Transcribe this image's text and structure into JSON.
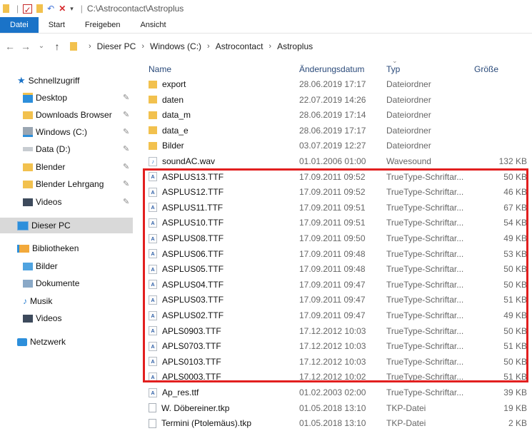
{
  "titlebar": {
    "path": "C:\\Astrocontact\\Astroplus",
    "icons": [
      "folder-icon",
      "properties-icon",
      "folder-icon",
      "undo-icon",
      "delete-icon",
      "dropdown-icon"
    ]
  },
  "ribbon": {
    "tabs": [
      "Datei",
      "Start",
      "Freigeben",
      "Ansicht"
    ],
    "accent": "#1a73c8"
  },
  "address": {
    "crumbs": [
      "Dieser PC",
      "Windows (C:)",
      "Astrocontact",
      "Astroplus"
    ]
  },
  "sidebar": {
    "items": [
      {
        "label": "Schnellzugriff",
        "icon": "star-icon",
        "pinned": false
      },
      {
        "label": "Desktop",
        "icon": "desktop-icon",
        "pinned": true
      },
      {
        "label": "Downloads Browser",
        "icon": "folder-icon",
        "pinned": true
      },
      {
        "label": "Windows (C:)",
        "icon": "drive-icon",
        "pinned": true
      },
      {
        "label": "Data (D:)",
        "icon": "drive-icon",
        "pinned": true
      },
      {
        "label": "Blender",
        "icon": "folder-icon",
        "pinned": true
      },
      {
        "label": "Blender Lehrgang",
        "icon": "folder-icon",
        "pinned": true
      },
      {
        "label": "Videos",
        "icon": "video-icon",
        "pinned": true
      },
      {
        "label": "Dieser PC",
        "icon": "computer-icon",
        "pinned": false,
        "selected": true
      },
      {
        "label": "Bibliotheken",
        "icon": "library-icon",
        "pinned": false
      },
      {
        "label": "Bilder",
        "icon": "pictures-icon",
        "pinned": false
      },
      {
        "label": "Dokumente",
        "icon": "documents-icon",
        "pinned": false
      },
      {
        "label": "Musik",
        "icon": "music-icon",
        "pinned": false
      },
      {
        "label": "Videos",
        "icon": "video-icon",
        "pinned": false
      },
      {
        "label": "Netzwerk",
        "icon": "network-icon",
        "pinned": false
      }
    ]
  },
  "columns": {
    "name": "Name",
    "date": "Änderungsdatum",
    "type": "Typ",
    "size": "Größe"
  },
  "files": [
    {
      "name": "export",
      "date": "28.06.2019 17:17",
      "type": "Dateiordner",
      "size": "",
      "icon": "folder"
    },
    {
      "name": "daten",
      "date": "22.07.2019 14:26",
      "type": "Dateiordner",
      "size": "",
      "icon": "folder"
    },
    {
      "name": "data_m",
      "date": "28.06.2019 17:14",
      "type": "Dateiordner",
      "size": "",
      "icon": "folder"
    },
    {
      "name": "data_e",
      "date": "28.06.2019 17:17",
      "type": "Dateiordner",
      "size": "",
      "icon": "folder"
    },
    {
      "name": "Bilder",
      "date": "03.07.2019 12:27",
      "type": "Dateiordner",
      "size": "",
      "icon": "folder"
    },
    {
      "name": "soundAC.wav",
      "date": "01.01.2006 01:00",
      "type": "Wavesound",
      "size": "132 KB",
      "icon": "wav"
    },
    {
      "name": "ASPLUS13.TTF",
      "date": "17.09.2011 09:52",
      "type": "TrueType-Schriftar...",
      "size": "50 KB",
      "icon": "ttf"
    },
    {
      "name": "ASPLUS12.TTF",
      "date": "17.09.2011 09:52",
      "type": "TrueType-Schriftar...",
      "size": "46 KB",
      "icon": "ttf"
    },
    {
      "name": "ASPLUS11.TTF",
      "date": "17.09.2011 09:51",
      "type": "TrueType-Schriftar...",
      "size": "67 KB",
      "icon": "ttf"
    },
    {
      "name": "ASPLUS10.TTF",
      "date": "17.09.2011 09:51",
      "type": "TrueType-Schriftar...",
      "size": "54 KB",
      "icon": "ttf"
    },
    {
      "name": "ASPLUS08.TTF",
      "date": "17.09.2011 09:50",
      "type": "TrueType-Schriftar...",
      "size": "49 KB",
      "icon": "ttf"
    },
    {
      "name": "ASPLUS06.TTF",
      "date": "17.09.2011 09:48",
      "type": "TrueType-Schriftar...",
      "size": "53 KB",
      "icon": "ttf"
    },
    {
      "name": "ASPLUS05.TTF",
      "date": "17.09.2011 09:48",
      "type": "TrueType-Schriftar...",
      "size": "50 KB",
      "icon": "ttf"
    },
    {
      "name": "ASPLUS04.TTF",
      "date": "17.09.2011 09:47",
      "type": "TrueType-Schriftar...",
      "size": "50 KB",
      "icon": "ttf"
    },
    {
      "name": "ASPLUS03.TTF",
      "date": "17.09.2011 09:47",
      "type": "TrueType-Schriftar...",
      "size": "51 KB",
      "icon": "ttf"
    },
    {
      "name": "ASPLUS02.TTF",
      "date": "17.09.2011 09:47",
      "type": "TrueType-Schriftar...",
      "size": "49 KB",
      "icon": "ttf"
    },
    {
      "name": "APLS0903.TTF",
      "date": "17.12.2012 10:03",
      "type": "TrueType-Schriftar...",
      "size": "50 KB",
      "icon": "ttf"
    },
    {
      "name": "APLS0703.TTF",
      "date": "17.12.2012 10:03",
      "type": "TrueType-Schriftar...",
      "size": "51 KB",
      "icon": "ttf"
    },
    {
      "name": "APLS0103.TTF",
      "date": "17.12.2012 10:03",
      "type": "TrueType-Schriftar...",
      "size": "50 KB",
      "icon": "ttf"
    },
    {
      "name": "APLS0003.TTF",
      "date": "17.12.2012 10:02",
      "type": "TrueType-Schriftar...",
      "size": "51 KB",
      "icon": "ttf"
    },
    {
      "name": "Ap_res.ttf",
      "date": "01.02.2003 02:00",
      "type": "TrueType-Schriftar...",
      "size": "39 KB",
      "icon": "ttf"
    },
    {
      "name": "W. Döbereiner.tkp",
      "date": "01.05.2018 13:10",
      "type": "TKP-Datei",
      "size": "19 KB",
      "icon": "doc"
    },
    {
      "name": "Termini (Ptolemäus).tkp",
      "date": "01.05.2018 13:10",
      "type": "TKP-Datei",
      "size": "2 KB",
      "icon": "doc"
    }
  ],
  "highlight_color": "#e21f1f"
}
